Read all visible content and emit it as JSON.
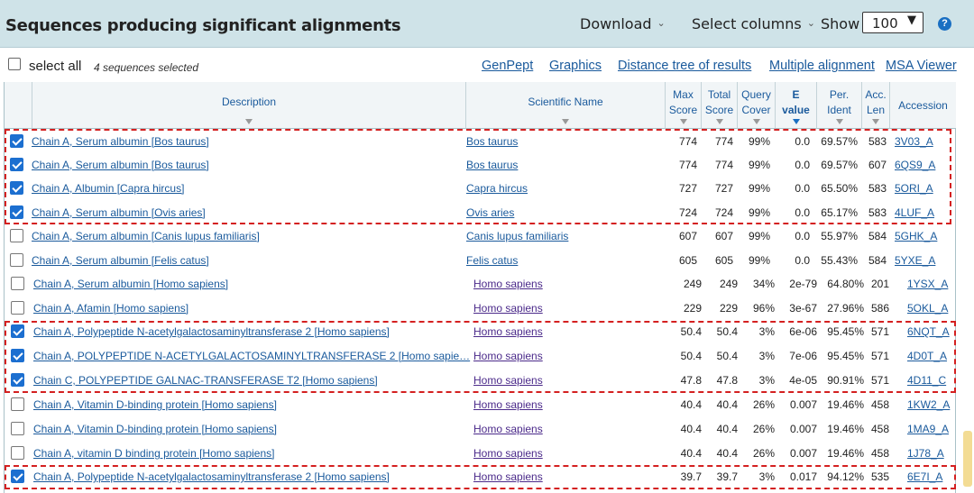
{
  "header": {
    "title": "Sequences producing significant alignments",
    "download_label": "Download",
    "select_columns_label": "Select columns",
    "show_label": "Show",
    "show_value": "100",
    "help_label": "?"
  },
  "toolbar": {
    "select_all_label": "select all",
    "selected_count": "4 sequences selected",
    "links": [
      "GenPept",
      "Graphics",
      "Distance tree of results",
      "Multiple alignment",
      "MSA Viewer"
    ]
  },
  "columns": {
    "description": "Description",
    "scientific_name": "Scientific Name",
    "max_score": [
      "Max",
      "Score"
    ],
    "total_score": [
      "Total",
      "Score"
    ],
    "query_cover": [
      "Query",
      "Cover"
    ],
    "e_value": [
      "E",
      "value"
    ],
    "per_ident": [
      "Per.",
      "Ident"
    ],
    "acc_len": [
      "Acc.",
      "Len"
    ],
    "accession": "Accession"
  },
  "rows": [
    {
      "checked": true,
      "desc": "Chain A, Serum albumin [Bos taurus]",
      "sci": "Bos taurus",
      "max": "774",
      "total": "774",
      "cover": "99%",
      "e": "0.0",
      "ident": "69.57%",
      "len": "583",
      "acc": "3V03_A"
    },
    {
      "checked": true,
      "desc": "Chain A, Serum albumin [Bos taurus]",
      "sci": "Bos taurus",
      "max": "774",
      "total": "774",
      "cover": "99%",
      "e": "0.0",
      "ident": "69.57%",
      "len": "607",
      "acc": "6QS9_A"
    },
    {
      "checked": true,
      "desc": "Chain A, Albumin [Capra hircus]",
      "sci": "Capra hircus",
      "max": "727",
      "total": "727",
      "cover": "99%",
      "e": "0.0",
      "ident": "65.50%",
      "len": "583",
      "acc": "5ORI_A"
    },
    {
      "checked": true,
      "desc": "Chain A, Serum albumin [Ovis aries]",
      "sci": "Ovis aries",
      "max": "724",
      "total": "724",
      "cover": "99%",
      "e": "0.0",
      "ident": "65.17%",
      "len": "583",
      "acc": "4LUF_A"
    },
    {
      "checked": false,
      "desc": "Chain A, Serum albumin [Canis lupus familiaris]",
      "sci": "Canis lupus familiaris",
      "max": "607",
      "total": "607",
      "cover": "99%",
      "e": "0.0",
      "ident": "55.97%",
      "len": "584",
      "acc": "5GHK_A"
    },
    {
      "checked": false,
      "desc": "Chain A, Serum albumin [Felis catus]",
      "sci": "Felis catus",
      "max": "605",
      "total": "605",
      "cover": "99%",
      "e": "0.0",
      "ident": "55.43%",
      "len": "584",
      "acc": "5YXE_A"
    },
    {
      "checked": false,
      "desc": "Chain A, Serum albumin [Homo sapiens]",
      "sci": "Homo sapiens",
      "max": "249",
      "total": "249",
      "cover": "34%",
      "e": "2e-79",
      "ident": "64.80%",
      "len": "201",
      "acc": "1YSX_A"
    },
    {
      "checked": false,
      "desc": "Chain A, Afamin [Homo sapiens]",
      "sci": "Homo sapiens",
      "max": "229",
      "total": "229",
      "cover": "96%",
      "e": "3e-67",
      "ident": "27.96%",
      "len": "586",
      "acc": "5OKL_A"
    },
    {
      "checked": true,
      "desc": "Chain A, Polypeptide N-acetylgalactosaminyltransferase 2 [Homo sapiens]",
      "sci": "Homo sapiens",
      "max": "50.4",
      "total": "50.4",
      "cover": "3%",
      "e": "6e-06",
      "ident": "95.45%",
      "len": "571",
      "acc": "6NQT_A"
    },
    {
      "checked": true,
      "desc": "Chain A, POLYPEPTIDE N-ACETYLGALACTOSAMINYLTRANSFERASE 2 [Homo sapie…",
      "sci": "Homo sapiens",
      "max": "50.4",
      "total": "50.4",
      "cover": "3%",
      "e": "7e-06",
      "ident": "95.45%",
      "len": "571",
      "acc": "4D0T_A"
    },
    {
      "checked": true,
      "desc": "Chain C, POLYPEPTIDE GALNAC-TRANSFERASE T2 [Homo sapiens]",
      "sci": "Homo sapiens",
      "max": "47.8",
      "total": "47.8",
      "cover": "3%",
      "e": "4e-05",
      "ident": "90.91%",
      "len": "571",
      "acc": "4D11_C"
    },
    {
      "checked": false,
      "desc": "Chain A, Vitamin D-binding protein [Homo sapiens]",
      "sci": "Homo sapiens",
      "max": "40.4",
      "total": "40.4",
      "cover": "26%",
      "e": "0.007",
      "ident": "19.46%",
      "len": "458",
      "acc": "1KW2_A"
    },
    {
      "checked": false,
      "desc": "Chain A, Vitamin D-binding protein [Homo sapiens]",
      "sci": "Homo sapiens",
      "max": "40.4",
      "total": "40.4",
      "cover": "26%",
      "e": "0.007",
      "ident": "19.46%",
      "len": "458",
      "acc": "1MA9_A"
    },
    {
      "checked": false,
      "desc": "Chain A, vitamin D binding protein [Homo sapiens]",
      "sci": "Homo sapiens",
      "max": "40.4",
      "total": "40.4",
      "cover": "26%",
      "e": "0.007",
      "ident": "19.46%",
      "len": "458",
      "acc": "1J78_A"
    },
    {
      "checked": true,
      "desc": "Chain A, Polypeptide N-acetylgalactosaminyltransferase 2 [Homo sapiens]",
      "sci": "Homo sapiens",
      "max": "39.7",
      "total": "39.7",
      "cover": "3%",
      "e": "0.017",
      "ident": "94.12%",
      "len": "535",
      "acc": "6E7I_A"
    }
  ],
  "colors": {
    "header_bg": "#cfe3e8",
    "link": "#1a5a9c",
    "checkbox_checked": "#1c6fd0",
    "highlight_dash": "#d42020"
  }
}
